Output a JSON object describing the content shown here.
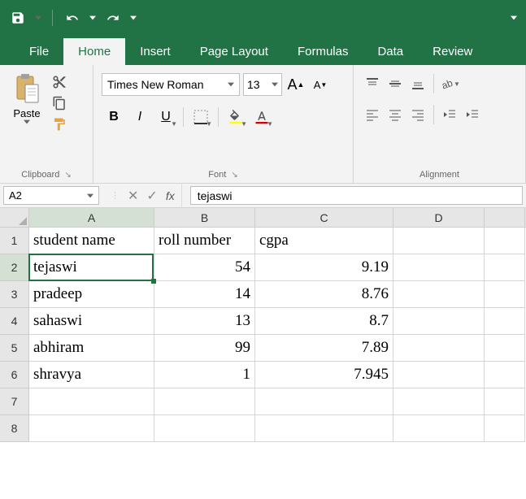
{
  "qat": {
    "save": "save-icon",
    "undo": "undo-icon",
    "redo": "redo-icon"
  },
  "tabs": {
    "file": "File",
    "home": "Home",
    "insert": "Insert",
    "page_layout": "Page Layout",
    "formulas": "Formulas",
    "data": "Data",
    "review": "Review"
  },
  "ribbon": {
    "clipboard": {
      "label": "Clipboard",
      "paste": "Paste"
    },
    "font": {
      "label": "Font",
      "name": "Times New Roman",
      "size": "13",
      "grow": "A",
      "shrink": "A",
      "bold": "B",
      "italic": "I",
      "underline": "U"
    },
    "alignment": {
      "label": "Alignment"
    }
  },
  "namebox": "A2",
  "formula_bar": "tejaswi",
  "columns": [
    "A",
    "B",
    "C",
    "D"
  ],
  "rows": [
    "1",
    "2",
    "3",
    "4",
    "5",
    "6",
    "7",
    "8"
  ],
  "active_cell": {
    "col": "A",
    "row": "2"
  },
  "sheet": {
    "headers": {
      "A": "student name",
      "B": "roll number",
      "C": "cgpa"
    },
    "data": [
      {
        "A": "tejaswi",
        "B": "54",
        "C": "9.19"
      },
      {
        "A": "pradeep",
        "B": "14",
        "C": "8.76"
      },
      {
        "A": "sahaswi",
        "B": "13",
        "C": "8.7"
      },
      {
        "A": "abhiram",
        "B": "99",
        "C": "7.89"
      },
      {
        "A": "shravya",
        "B": "1",
        "C": "7.945"
      }
    ]
  },
  "chart_data": {
    "type": "table",
    "columns": [
      "student name",
      "roll number",
      "cgpa"
    ],
    "rows": [
      [
        "tejaswi",
        54,
        9.19
      ],
      [
        "pradeep",
        14,
        8.76
      ],
      [
        "sahaswi",
        13,
        8.7
      ],
      [
        "abhiram",
        99,
        7.89
      ],
      [
        "shravya",
        1,
        7.945
      ]
    ]
  }
}
